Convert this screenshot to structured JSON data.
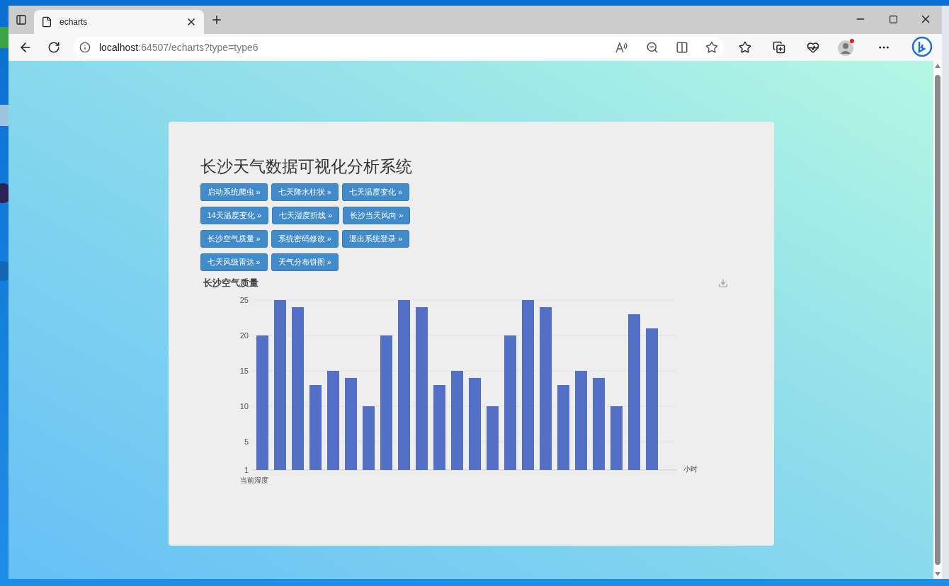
{
  "browser": {
    "tabs": [
      {
        "title": "echarts",
        "selected": true
      }
    ],
    "address": {
      "host": "localhost",
      "path": ":64507/echarts?type=type6"
    }
  },
  "page": {
    "title": "长沙天气数据可视化分析系统",
    "buttons": [
      [
        "启动系统爬虫 »",
        "七天降水柱状 »",
        "七天温度变化 »"
      ],
      [
        "14天温度变化 »",
        "七天湿度折线 »",
        "长沙当天风向 »"
      ],
      [
        "长沙空气质量 »",
        "系统密码修改 »",
        "退出系统登录 »"
      ],
      [
        "七天风级雷达 »",
        "天气分布饼图 »"
      ]
    ],
    "chart": {
      "title": "长沙空气质量",
      "chart_data": {
        "type": "bar",
        "xlabel": "小时",
        "ylabel": "当前湿度",
        "ylim": [
          1,
          25
        ],
        "grid": true,
        "yticks": [
          1,
          5,
          10,
          15,
          20,
          25
        ],
        "series": [
          {
            "color": "#5470c6",
            "values": [
              20,
              25,
              24,
              13,
              15,
              14,
              10,
              20,
              25,
              24,
              13,
              15,
              14,
              10,
              20,
              25,
              24,
              13,
              15,
              14,
              10,
              23,
              21
            ]
          }
        ]
      }
    }
  }
}
